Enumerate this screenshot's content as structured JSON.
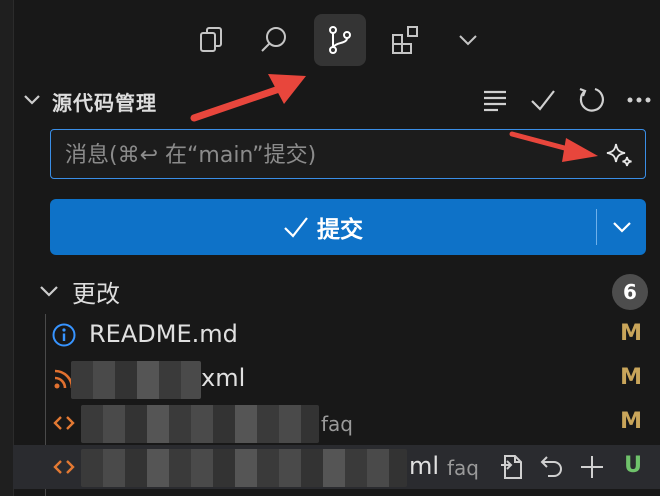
{
  "activity_bar": {
    "items": [
      {
        "icon": "copy-icon",
        "active": false
      },
      {
        "icon": "search-icon",
        "active": false
      },
      {
        "icon": "source-control-icon",
        "active": true
      },
      {
        "icon": "extensions-icon",
        "active": false
      },
      {
        "icon": "chevron-down-icon",
        "active": false
      }
    ]
  },
  "section": {
    "title": "源代码管理",
    "actions": [
      "view-as-tree-icon",
      "check-icon",
      "refresh-icon",
      "more-icon"
    ]
  },
  "commit": {
    "placeholder": "消息(⌘↩ 在“main”提交)",
    "value": "",
    "button_label": "提交",
    "sparkle_icon": "sparkle-icon"
  },
  "changes": {
    "title": "更改",
    "count": "6",
    "files": [
      {
        "name": "README.md",
        "dir": "",
        "status": "M",
        "icon": "info-icon",
        "redacted": false
      },
      {
        "name": "xml",
        "dir": "",
        "status": "M",
        "icon": "rss-icon",
        "redacted": true
      },
      {
        "name": "",
        "dir": "faq",
        "status": "M",
        "icon": "code-icon",
        "redacted": true
      },
      {
        "name": "ml",
        "dir": "faq",
        "status": "U",
        "icon": "code-icon",
        "redacted": true,
        "selected": true
      }
    ]
  },
  "colors": {
    "accent": "#0e72c8",
    "modified": "#c9a55a",
    "untracked": "#6fc26b",
    "info_icon": "#3794ff",
    "rss_icon": "#e0702f",
    "code_icon": "#e37933"
  }
}
